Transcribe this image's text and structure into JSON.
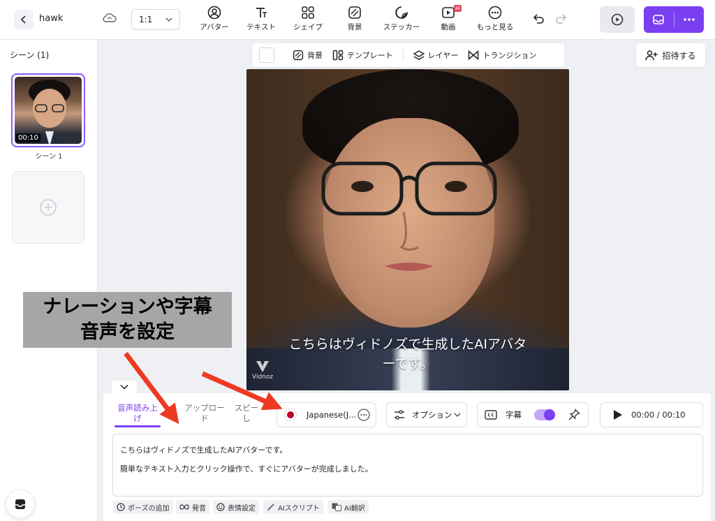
{
  "header": {
    "project_name": "hawk",
    "ratio": "1:1",
    "tools": [
      {
        "label": "アバター",
        "icon": "avatar-icon"
      },
      {
        "label": "テキスト",
        "icon": "text-icon"
      },
      {
        "label": "シェイプ",
        "icon": "shapes-icon"
      },
      {
        "label": "背景",
        "icon": "background-icon"
      },
      {
        "label": "ステッカー",
        "icon": "sticker-icon"
      },
      {
        "label": "動画",
        "icon": "video-icon",
        "badge": "AI"
      },
      {
        "label": "もっと見る",
        "icon": "more-icon"
      }
    ]
  },
  "sidebar": {
    "title": "シーン (1)",
    "scenes": [
      {
        "label": "シーン 1",
        "duration": "00:10"
      }
    ]
  },
  "canvas_toolbar": {
    "background": "背景",
    "template": "テンプレート",
    "layer": "レイヤー",
    "transition": "トランジション"
  },
  "invite_label": "招待する",
  "video": {
    "subtitle_line1": "こちらはヴィドノズで生成したAIアバタ",
    "subtitle_line2": "ーです。",
    "watermark": "Vidnoz"
  },
  "panel": {
    "tabs": [
      {
        "line1": "音声読み上",
        "line2": "げ"
      },
      {
        "line1": "アップロー",
        "line2": "ド"
      },
      {
        "line1": "スピー",
        "line2": "し"
      }
    ],
    "language": "Japanese(J...",
    "options_label": "オプション",
    "caption_label": "字幕",
    "time": "00:00 / 00:10",
    "script_line1": "こちらはヴィドノズで生成したAIアバターです。",
    "script_line2": "簡単なテキスト入力とクリック操作で、すぐにアバターが完成しました。",
    "chips": [
      {
        "label": "ポーズの追加",
        "icon": "clock-icon"
      },
      {
        "label": "発音",
        "icon": "infinity-icon"
      },
      {
        "label": "表情設定",
        "icon": "smile-icon"
      },
      {
        "label": "AIスクリプト",
        "icon": "magic-wand-icon"
      },
      {
        "label": "AI翻訳",
        "icon": "translate-icon"
      }
    ]
  },
  "annotation": {
    "line1": "ナレーションや字幕",
    "line2": "音声を設定",
    "color": "#ee3a23"
  },
  "colors": {
    "accent": "#7b3ff2"
  }
}
